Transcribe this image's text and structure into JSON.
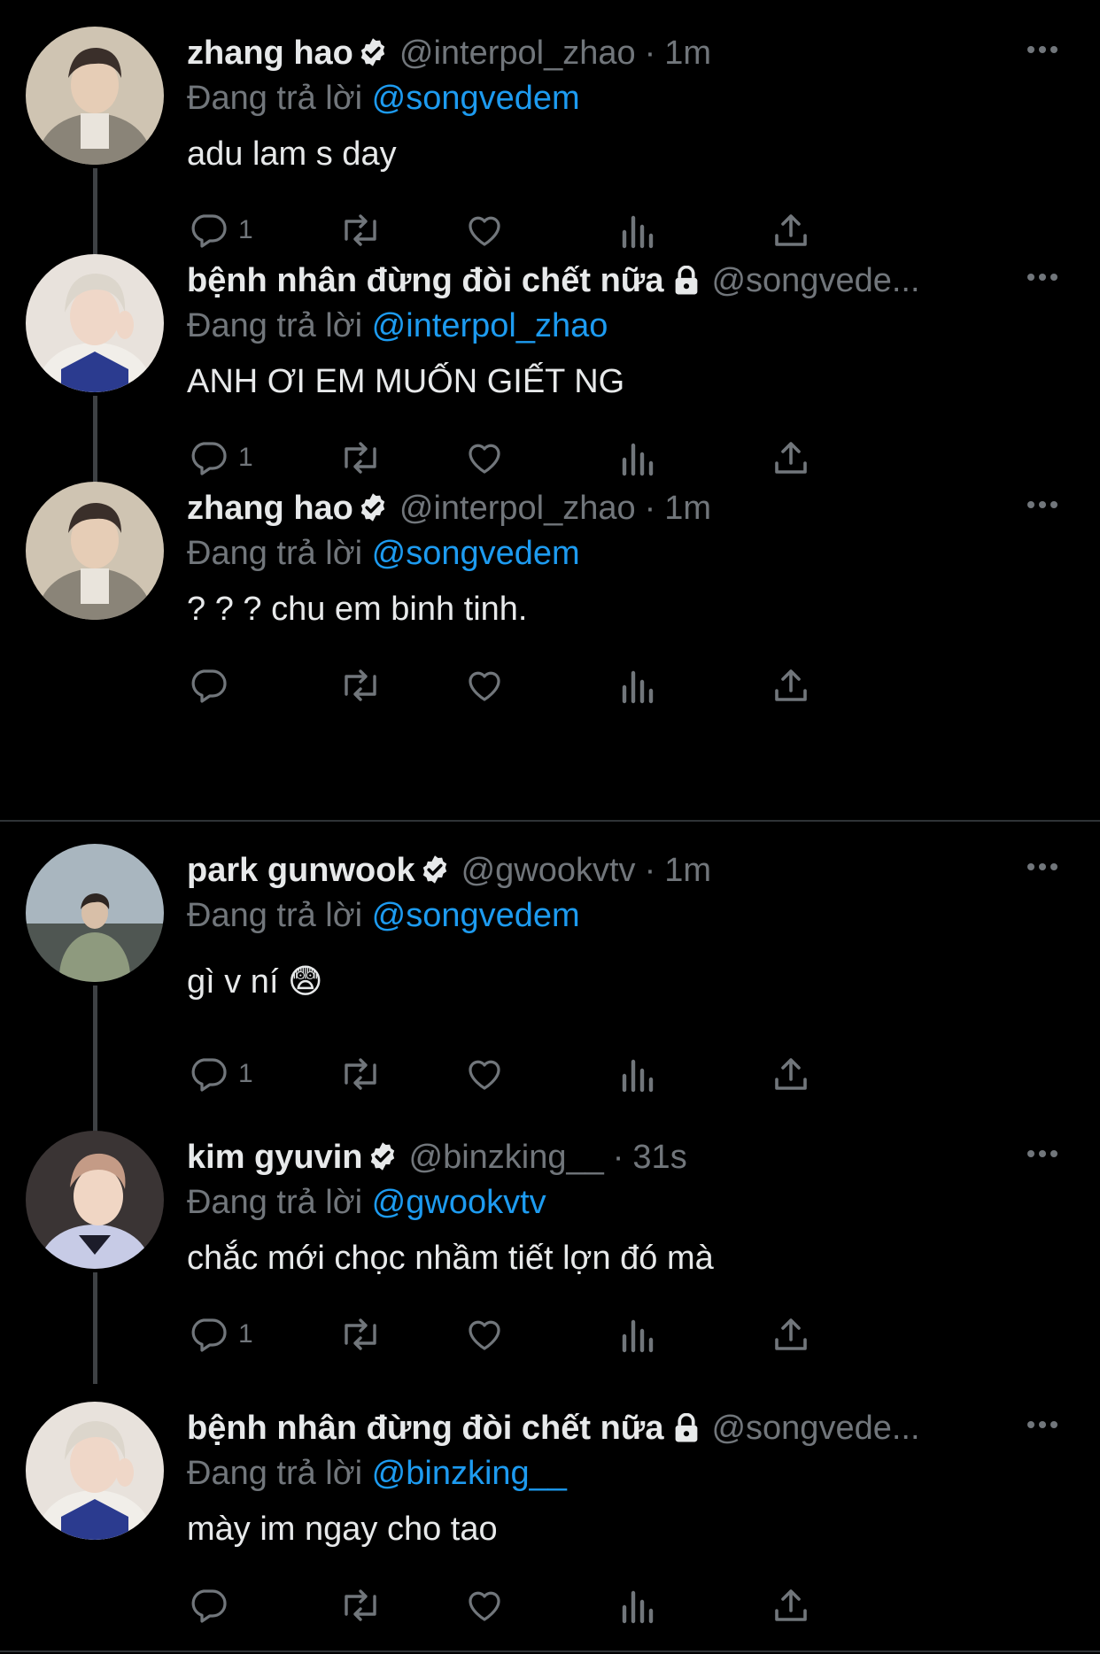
{
  "reply_prefix": "Đang trả lời",
  "tweets": [
    {
      "name": "zhang hao",
      "verified": true,
      "locked": false,
      "handle": "@interpol_zhao",
      "sep": "·",
      "time": "1m",
      "reply_to": "@songvedem",
      "text": "adu lam s day",
      "reply_count": "1"
    },
    {
      "name": "bệnh nhân đừng đòi chết nữa",
      "verified": false,
      "locked": true,
      "handle": "@songvede...",
      "sep": "",
      "time": "",
      "reply_to": "@interpol_zhao",
      "text": "ANH ƠI EM MUỐN GIẾT NG",
      "reply_count": "1"
    },
    {
      "name": "zhang hao",
      "verified": true,
      "locked": false,
      "handle": "@interpol_zhao",
      "sep": "·",
      "time": "1m",
      "reply_to": "@songvedem",
      "text": "? ? ? chu em binh tinh.",
      "reply_count": ""
    },
    {
      "name": "park gunwook",
      "verified": true,
      "locked": false,
      "handle": "@gwookvtv",
      "sep": "·",
      "time": "1m",
      "reply_to": "@songvedem",
      "text": "gì v ní 😨",
      "reply_count": "1"
    },
    {
      "name": "kim gyuvin",
      "verified": true,
      "locked": false,
      "handle": "@binzking__",
      "sep": "·",
      "time": "31s",
      "reply_to": "@gwookvtv",
      "text": "chắc mới chọc nhầm tiết lợn đó mà",
      "reply_count": "1"
    },
    {
      "name": "bệnh nhân đừng đòi chết nữa",
      "verified": false,
      "locked": true,
      "handle": "@songvede...",
      "sep": "",
      "time": "",
      "reply_to": "@binzking__",
      "text": "mày im ngay cho tao",
      "reply_count": ""
    }
  ],
  "colors": {
    "background": "#000000",
    "text": "#e7e9ea",
    "muted": "#71767b",
    "accent": "#1d9bf0",
    "divider": "#2f3336"
  },
  "icons": [
    "verified-badge-icon",
    "lock-icon",
    "more-icon",
    "reply-icon",
    "retweet-icon",
    "like-icon",
    "views-icon",
    "share-icon"
  ]
}
